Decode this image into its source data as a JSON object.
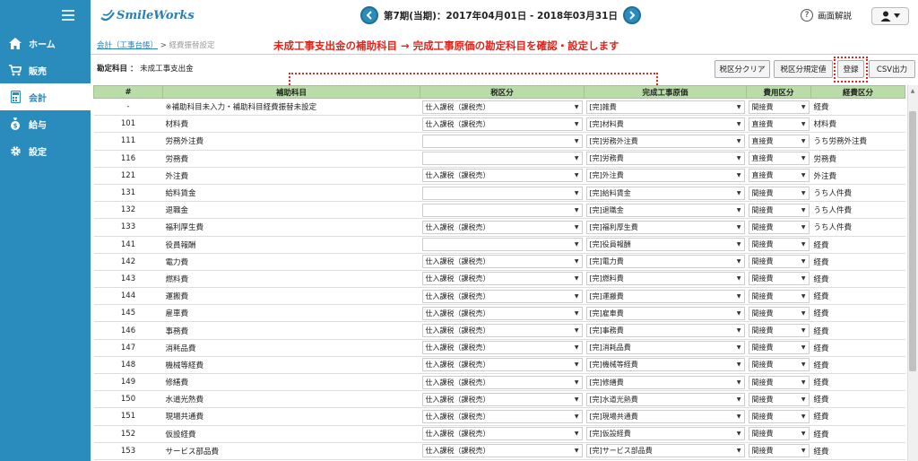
{
  "app": {
    "logo_text": "SmileWorks"
  },
  "header": {
    "period": "第7期(当期)：2017年04月01日 - 2018年03月31日",
    "help_label": "画面解説"
  },
  "sidebar": {
    "items": [
      {
        "label": "ホーム",
        "icon": "home-icon"
      },
      {
        "label": "販売",
        "icon": "cart-icon"
      },
      {
        "label": "会計",
        "icon": "calculator-icon"
      },
      {
        "label": "給与",
        "icon": "money-bag-icon"
      },
      {
        "label": "設定",
        "icon": "gear-icon"
      }
    ]
  },
  "breadcrumb": {
    "parent": "会計（工事台帳）",
    "sep": ">",
    "current": "経費振替設定"
  },
  "instruction": "未成工事支出金の補助科目 → 完成工事原価の勘定科目を確認・設定します",
  "account": {
    "label": "勘定科目 ：",
    "value": "未成工事支出金"
  },
  "toolbar": {
    "clear_label": "税区分クリア",
    "default_label": "税区分規定値",
    "register_label": "登録",
    "csv_label": "CSV出力"
  },
  "table": {
    "headers": [
      "#",
      "補助科目",
      "税区分",
      "完成工事原価",
      "費用区分",
      "経費区分"
    ],
    "rows": [
      {
        "no": "-",
        "name": "※補助科目未入力・補助科目経費振替未設定",
        "tax": "仕入課税（課税売）",
        "cost": "[完]雑費",
        "type": "間接費",
        "cat": "経費"
      },
      {
        "no": "101",
        "name": "材料費",
        "tax": "仕入課税（課税売）",
        "cost": "[完]材料費",
        "type": "直接費",
        "cat": "材料費"
      },
      {
        "no": "111",
        "name": "労務外注費",
        "tax": "",
        "cost": "[完]労務外注費",
        "type": "直接費",
        "cat": "うち労務外注費"
      },
      {
        "no": "116",
        "name": "労務費",
        "tax": "",
        "cost": "[完]労務費",
        "type": "直接費",
        "cat": "労務費"
      },
      {
        "no": "121",
        "name": "外注費",
        "tax": "仕入課税（課税売）",
        "cost": "[完]外注費",
        "type": "直接費",
        "cat": "外注費"
      },
      {
        "no": "131",
        "name": "給料賃金",
        "tax": "",
        "cost": "[完]給料賃金",
        "type": "間接費",
        "cat": "うち人件費"
      },
      {
        "no": "132",
        "name": "退職金",
        "tax": "",
        "cost": "[完]退職金",
        "type": "間接費",
        "cat": "うち人件費"
      },
      {
        "no": "133",
        "name": "福利厚生費",
        "tax": "仕入課税（課税売）",
        "cost": "[完]福利厚生費",
        "type": "間接費",
        "cat": "うち人件費"
      },
      {
        "no": "141",
        "name": "役員報酬",
        "tax": "",
        "cost": "[完]役員報酬",
        "type": "間接費",
        "cat": "経費"
      },
      {
        "no": "142",
        "name": "電力費",
        "tax": "仕入課税（課税売）",
        "cost": "[完]電力費",
        "type": "間接費",
        "cat": "経費"
      },
      {
        "no": "143",
        "name": "燃料費",
        "tax": "仕入課税（課税売）",
        "cost": "[完]燃料費",
        "type": "間接費",
        "cat": "経費"
      },
      {
        "no": "144",
        "name": "運搬費",
        "tax": "仕入課税（課税売）",
        "cost": "[完]運搬費",
        "type": "間接費",
        "cat": "経費"
      },
      {
        "no": "145",
        "name": "雇車費",
        "tax": "仕入課税（課税売）",
        "cost": "[完]雇車費",
        "type": "間接費",
        "cat": "経費"
      },
      {
        "no": "146",
        "name": "事務費",
        "tax": "仕入課税（課税売）",
        "cost": "[完]事務費",
        "type": "間接費",
        "cat": "経費"
      },
      {
        "no": "147",
        "name": "消耗品費",
        "tax": "仕入課税（課税売）",
        "cost": "[完]消耗品費",
        "type": "間接費",
        "cat": "経費"
      },
      {
        "no": "148",
        "name": "機械等経費",
        "tax": "仕入課税（課税売）",
        "cost": "[完]機械等経費",
        "type": "間接費",
        "cat": "経費"
      },
      {
        "no": "149",
        "name": "修繕費",
        "tax": "仕入課税（課税売）",
        "cost": "[完]修繕費",
        "type": "間接費",
        "cat": "経費"
      },
      {
        "no": "150",
        "name": "水道光熱費",
        "tax": "仕入課税（課税売）",
        "cost": "[完]水道光熱費",
        "type": "間接費",
        "cat": "経費"
      },
      {
        "no": "151",
        "name": "現場共通費",
        "tax": "仕入課税（課税売）",
        "cost": "[完]現場共通費",
        "type": "間接費",
        "cat": "経費"
      },
      {
        "no": "152",
        "name": "仮設経費",
        "tax": "仕入課税（課税売）",
        "cost": "[完]仮設経費",
        "type": "間接費",
        "cat": "経費"
      },
      {
        "no": "153",
        "name": "サービス部品費",
        "tax": "仕入課税（課税売）",
        "cost": "[完]サービス部品費",
        "type": "間接費",
        "cat": "経費"
      }
    ]
  }
}
